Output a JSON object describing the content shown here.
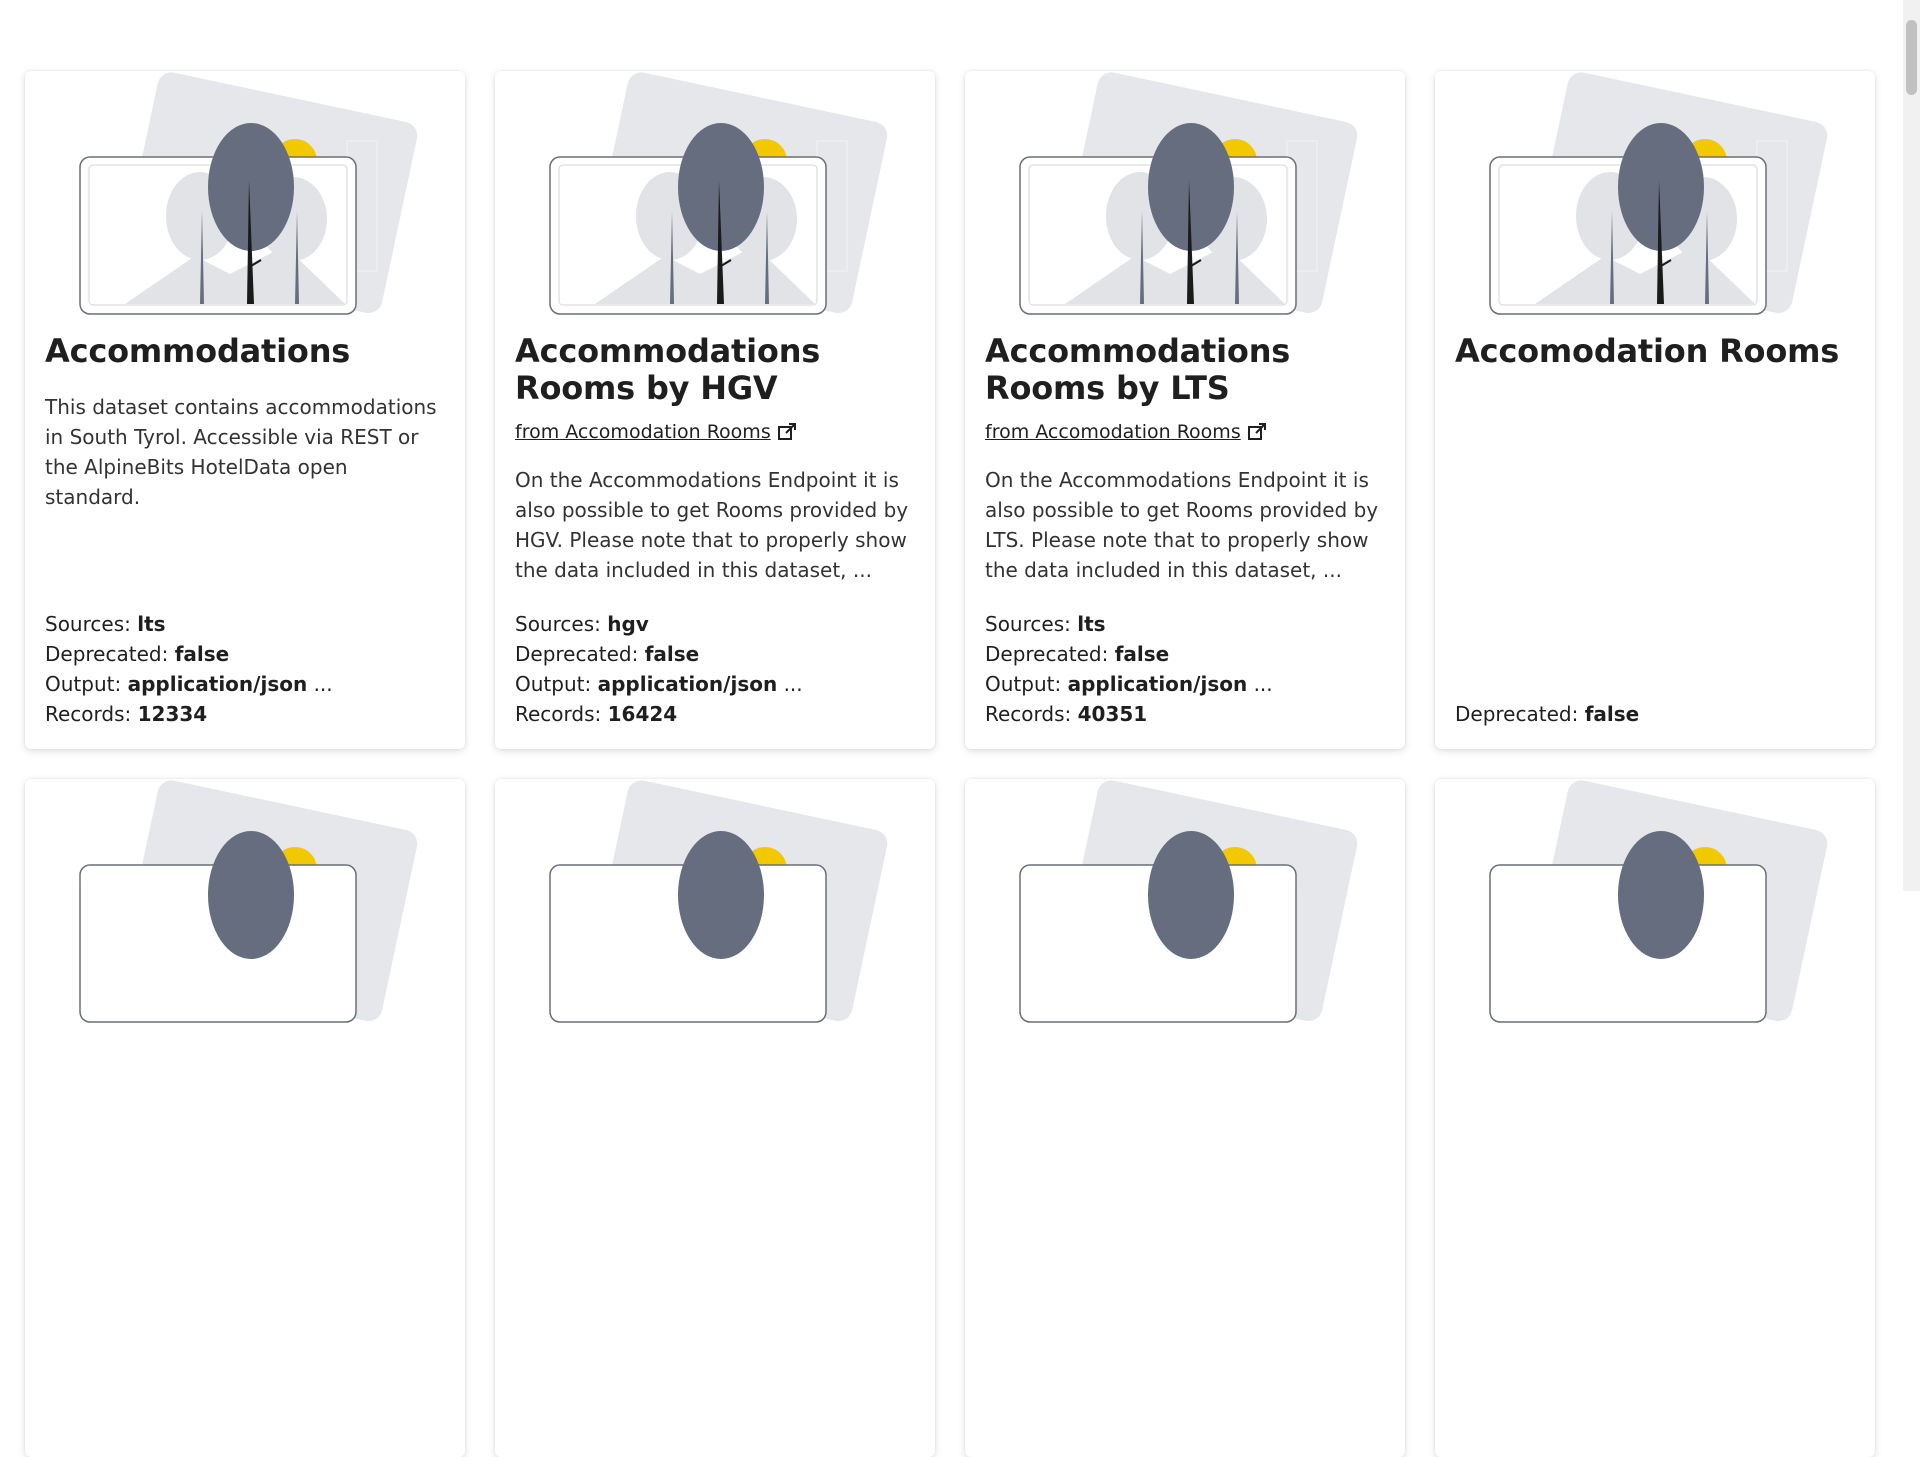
{
  "cards": [
    {
      "title": "Accommodations",
      "from": "",
      "description": "This dataset contains accommodations in South Tyrol. Accessible via REST or the AlpineBits HotelData open standard.",
      "meta": {
        "sources_label": "Sources: ",
        "sources_value": "lts",
        "deprecated_label": "Deprecated: ",
        "deprecated_value": "false",
        "output_label": "Output: ",
        "output_value": "application/json",
        "output_more": " ...",
        "records_label": "Records: ",
        "records_value": "12334"
      }
    },
    {
      "title": "Accommodations Rooms by HGV",
      "from": "from Accomodation Rooms",
      "description": "On the Accommodations Endpoint it is also possible to get Rooms provided by HGV. Please note that to properly show the data included in this dataset, ...",
      "meta": {
        "sources_label": "Sources: ",
        "sources_value": "hgv",
        "deprecated_label": "Deprecated: ",
        "deprecated_value": "false",
        "output_label": "Output: ",
        "output_value": "application/json",
        "output_more": " ...",
        "records_label": "Records: ",
        "records_value": "16424"
      }
    },
    {
      "title": "Accommodations Rooms by LTS",
      "from": "from Accomodation Rooms",
      "description": "On the Accommodations Endpoint it is also possible to get Rooms provided by LTS. Please note that to properly show the data included in this dataset, ...",
      "meta": {
        "sources_label": "Sources: ",
        "sources_value": "lts",
        "deprecated_label": "Deprecated: ",
        "deprecated_value": "false",
        "output_label": "Output: ",
        "output_value": "application/json",
        "output_more": " ...",
        "records_label": "Records: ",
        "records_value": "40351"
      }
    },
    {
      "title": "Accomodation Rooms",
      "from": "",
      "description": "",
      "meta": {
        "deprecated_label": "Deprecated: ",
        "deprecated_value": "false"
      }
    }
  ],
  "colors": {
    "tree_dark": "#656d7e",
    "tree_light": "#e2e3e7",
    "sun": "#f2c800",
    "frame_back": "#e6e7ea"
  },
  "icons": {
    "external": "external-link-icon",
    "illustration": "placeholder-image-illustration"
  }
}
